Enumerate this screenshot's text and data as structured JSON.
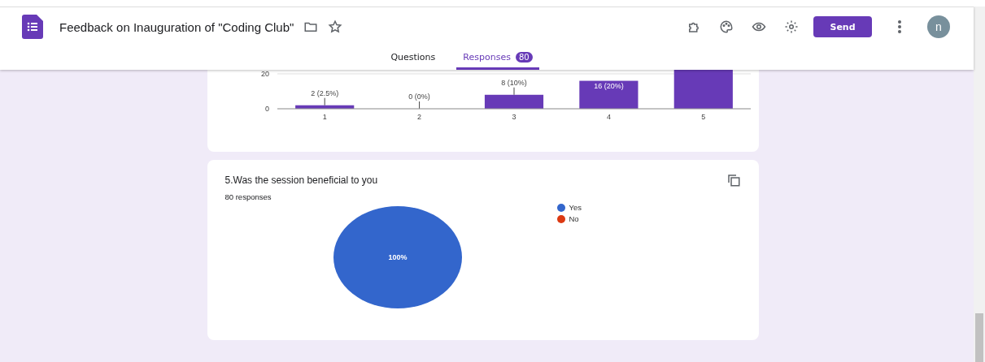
{
  "header": {
    "title": "Feedback on Inauguration of \"Coding Club\"",
    "send_button": "Send",
    "avatar": "n"
  },
  "tabs": [
    {
      "label": "Questions",
      "selected": false
    },
    {
      "label": "Responses",
      "selected": true,
      "badge": "80"
    }
  ],
  "questions": [
    {
      "kind": "chart",
      "chart_data": {
        "type": "bar",
        "categories": [
          "1",
          "2",
          "3",
          "4",
          "5"
        ],
        "values": [
          2,
          0,
          8,
          16,
          22.3
        ],
        "ylim": [
          0,
          22.3
        ],
        "yticks": [
          0,
          20
        ],
        "value_labels": [
          "2 (2.5%)",
          "0 (0%)",
          "8 (10%)",
          "16 (20%)",
          null
        ],
        "color": "#673ab7"
      }
    },
    {
      "kind": "chart",
      "title": "5.Was the session beneficial to you",
      "responses": "80 responses",
      "chart_data": {
        "type": "pie",
        "categories": [
          "Yes",
          "No"
        ],
        "values": [
          100,
          0
        ],
        "colors": [
          "#3366cc",
          "#dc3912"
        ],
        "value_labels": [
          "100%",
          null
        ]
      }
    }
  ]
}
